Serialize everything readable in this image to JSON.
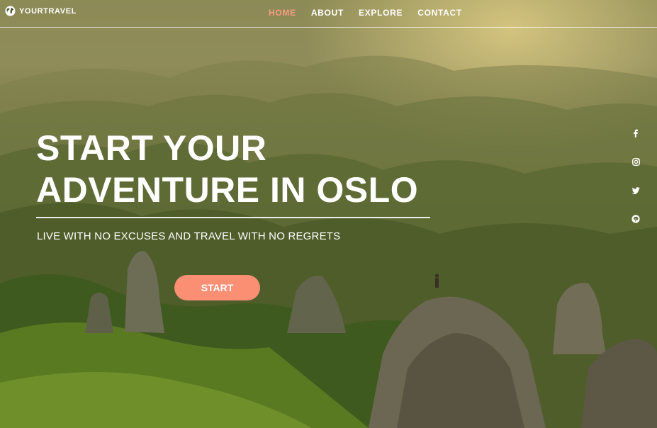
{
  "brand": {
    "name": "YOURTRAVEL",
    "icon": "globe-icon"
  },
  "nav": {
    "items": [
      {
        "label": "HOME",
        "active": true
      },
      {
        "label": "ABOUT",
        "active": false
      },
      {
        "label": "EXPLORE",
        "active": false
      },
      {
        "label": "CONTACT",
        "active": false
      }
    ]
  },
  "hero": {
    "title_line1": "START YOUR",
    "title_line2": "ADVENTURE IN OSLO",
    "subtitle": "LIVE WITH NO EXCUSES AND TRAVEL WITH NO REGRETS",
    "cta_label": "START"
  },
  "social": [
    "facebook-icon",
    "instagram-icon",
    "twitter-icon",
    "pinterest-icon"
  ],
  "colors": {
    "accent": "#f79d82",
    "button": "#fa8f74",
    "text": "#ffffff"
  }
}
